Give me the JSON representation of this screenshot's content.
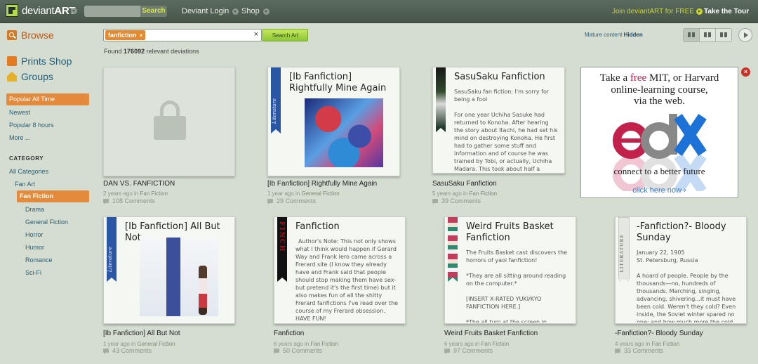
{
  "topbar": {
    "logo_text_regular": "deviant",
    "logo_text_bold": "ART",
    "search_button": "Search",
    "nav": [
      "Deviant Login",
      "Shop"
    ],
    "join": "Join deviantART for FREE",
    "tour": "Take the Tour"
  },
  "sidebar": {
    "browse": "Browse",
    "prints_shop": "Prints Shop",
    "groups": "Groups",
    "sort": [
      "Popular All Time",
      "Newest",
      "Popular 8 hours",
      "More ..."
    ],
    "category_heading": "CATEGORY",
    "categories": {
      "all": "All Categories",
      "fan_art": "Fan Art",
      "fan_fiction": "Fan Fiction",
      "subs": [
        "Drama",
        "General Fiction",
        "Horror",
        "Humor",
        "Romance",
        "Sci-Fi"
      ]
    }
  },
  "search": {
    "tag": "fanfiction",
    "tag_remove": "×",
    "clear": "×",
    "button": "Search Art",
    "found_prefix": "Found",
    "found_count": "176092",
    "found_suffix": "relevant deviations"
  },
  "mature": {
    "label": "Mature content",
    "value": "Hidden"
  },
  "cards": [
    {
      "caption": "DAN VS. FANFICTION",
      "time": "2 years ago in",
      "category": "Fan Fiction",
      "comments": "108 Comments"
    },
    {
      "title": "[Ib Fanfiction] Rightfully Mine Again",
      "ribbon": "Literature",
      "caption": "[Ib Fanfiction] Rightfully Mine Again",
      "time": "1 year ago in",
      "category": "General Fiction",
      "comments": "29 Comments"
    },
    {
      "title": "SasuSaku Fanfiction",
      "text": "SasuSaku fan fiction: I'm sorry for being a fool\n\nFor one year Uchiha Sasuke had returned to Konoha. After hearing the story about Itachi, he had set his mind on destroying Konoha. He first had to gather some stuff and information and of course he was trained by Tobi, or actually, Uchiha Madara. This took about half a",
      "caption": "SasuSaku Fanfiction",
      "time": "5 years ago in",
      "category": "Fan Fiction",
      "comments": "39 Comments"
    },
    {
      "title": "[Ib Fanfiction] All But Not",
      "ribbon": "Literature",
      "caption": "[Ib Fanfiction] All But Not",
      "time": "1 year ago in",
      "category": "General Fiction",
      "comments": "43 Comments"
    },
    {
      "title": "Fanfiction",
      "ribbon": "FINCH",
      "text": "Author's Note: This not only shows what I think would happen if Gerard Way and Frank Iero came across a Frerard site (I know they already have and Frank said that people should stop making them have sex- but pretend it's the first time) but it also makes fun of all the shitty Frerard fanfictions I've read over the course of my Frerard obsession. HAVE FUN!",
      "caption": "Fanfiction",
      "time": "6 years ago in",
      "category": "Fan Fiction",
      "comments": "50 Comments"
    },
    {
      "title": "Weird Fruits Basket Fanfiction",
      "text": "The Fruits Basket cast discovers the horrors of yaoi fanfiction!\n\n*They are all sitting around reading on the computer.*\n\n[INSERT X-RATED YUKI/KYO FANFICTION HERE.]\n\n*The all turn at the screen in",
      "caption": "Weird Fruits Basket Fanfiction",
      "time": "6 years ago in",
      "category": "Fan Fiction",
      "comments": "97 Comments"
    },
    {
      "title": "-Fanfiction?- Bloody Sunday",
      "ribbon": "LITERATURE",
      "text": "January 22, 1905\nSt. Petersburg, Russia\n\nA hoard of people. People by the thousands—no, hundreds of thousands. Marching, singing, advancing, shivering...it must have been cold. Weren't they cold? Even inside, the Soviet winter spared no one; and how much more the cold",
      "caption": "-Fanfiction?- Bloody Sunday",
      "time": "4 years ago in",
      "category": "Fan Fiction",
      "comments": "33 Comments"
    }
  ],
  "ad": {
    "line1_a": "Take a",
    "line1_free": "free",
    "line1_b": "MIT, or Harvard",
    "line2": "online-learning course,",
    "line3": "via the web.",
    "tagline": "connect to a better future",
    "cta": "click here now ›",
    "close": "×"
  },
  "colors": {
    "accent_orange": "#e38a3c",
    "topbar": "#485649",
    "join_yellow": "#c9d630",
    "background": "#d5ddd1"
  }
}
